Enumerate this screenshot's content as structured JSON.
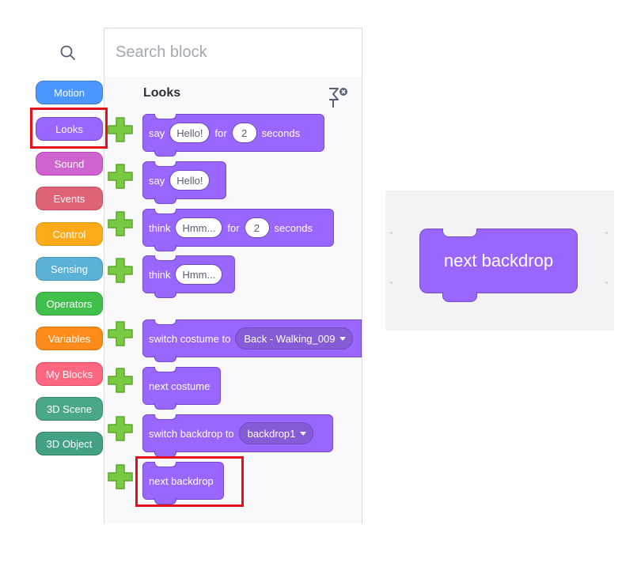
{
  "search": {
    "placeholder": "Search block"
  },
  "categories": [
    {
      "label": "Motion",
      "color": "#4c97ff"
    },
    {
      "label": "Looks",
      "color": "#9966ff"
    },
    {
      "label": "Sound",
      "color": "#cf63cf"
    },
    {
      "label": "Events",
      "color": "#de6375"
    },
    {
      "label": "Control",
      "color": "#ffab19"
    },
    {
      "label": "Sensing",
      "color": "#5cb1d6"
    },
    {
      "label": "Operators",
      "color": "#40bf4a"
    },
    {
      "label": "Variables",
      "color": "#ff8c1a"
    },
    {
      "label": "My Blocks",
      "color": "#ff6680"
    },
    {
      "label": "3D Scene",
      "color": "#4aa787"
    },
    {
      "label": "3D Object",
      "color": "#42a283"
    }
  ],
  "selected_category": "Looks",
  "section": {
    "title": "Looks"
  },
  "blocks": {
    "say_for": {
      "say": "say",
      "text": "Hello!",
      "for": "for",
      "num": "2",
      "seconds": "seconds"
    },
    "say": {
      "say": "say",
      "text": "Hello!"
    },
    "think_for": {
      "think": "think",
      "text": "Hmm...",
      "for": "for",
      "num": "2",
      "seconds": "seconds"
    },
    "think": {
      "think": "think",
      "text": "Hmm..."
    },
    "switch_costume": {
      "label": "switch costume to",
      "value": "Back - Walking_009"
    },
    "next_costume": {
      "label": "next costume"
    },
    "switch_backdrop": {
      "label": "switch backdrop to",
      "value": "backdrop1"
    },
    "next_backdrop": {
      "label": "next backdrop"
    }
  },
  "preview": {
    "label": "next backdrop"
  },
  "colors": {
    "looks_block": "#9966ff",
    "highlight": "#e5111a",
    "add_icon": "#7ac943"
  }
}
